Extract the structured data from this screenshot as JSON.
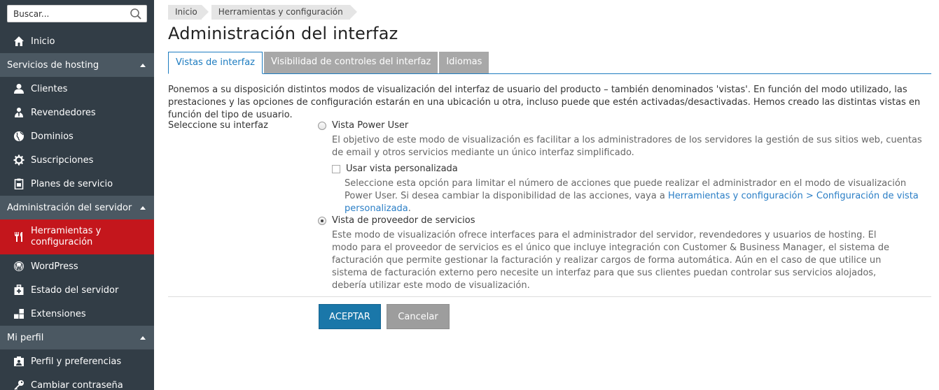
{
  "sidebar": {
    "search": {
      "placeholder": "Buscar..."
    },
    "items": [
      {
        "label": "Inicio",
        "icon": "home-icon"
      }
    ],
    "sections": [
      {
        "title": "Servicios de hosting",
        "items": [
          {
            "label": "Clientes",
            "icon": "user-icon"
          },
          {
            "label": "Revendedores",
            "icon": "reseller-icon"
          },
          {
            "label": "Dominios",
            "icon": "globe-icon"
          },
          {
            "label": "Suscripciones",
            "icon": "gear-icon"
          },
          {
            "label": "Planes de servicio",
            "icon": "plan-icon"
          }
        ]
      },
      {
        "title": "Administración del servidor",
        "items": [
          {
            "label": "Herramientas y configuración",
            "icon": "tools-icon",
            "active": true
          },
          {
            "label": "WordPress",
            "icon": "wordpress-icon"
          },
          {
            "label": "Estado del servidor",
            "icon": "server-status-icon"
          },
          {
            "label": "Extensiones",
            "icon": "extensions-icon"
          }
        ]
      },
      {
        "title": "Mi perfil",
        "items": [
          {
            "label": "Perfil y preferencias",
            "icon": "profile-icon"
          },
          {
            "label": "Cambiar contraseña",
            "icon": "key-icon"
          }
        ]
      }
    ]
  },
  "breadcrumb": [
    "Inicio",
    "Herramientas y configuración"
  ],
  "page_title": "Administración del interfaz",
  "tabs": [
    {
      "label": "Vistas de interfaz",
      "active": true
    },
    {
      "label": "Visibilidad de controles del interfaz",
      "active": false
    },
    {
      "label": "Idiomas",
      "active": false
    }
  ],
  "description": "Ponemos a su disposición distintos modos de visualización del interfaz de usuario del producto – también denominados 'vistas'. En función del modo utilizado, las prestaciones y las opciones de configuración estarán en una ubicación u otra, incluso puede que estén activadas/desactivadas. Hemos creado las distintas vistas en función del tipo de usuario.",
  "form": {
    "label": "Seleccione su interfaz",
    "option_power": {
      "label": "Vista Power User",
      "help": "El objetivo de este modo de visualización es facilitar a los administradores de los servidores la gestión de sus sitios web, cuentas de email y otros servicios mediante un único interfaz simplificado.",
      "checked": false
    },
    "custom_view": {
      "label": "Usar vista personalizada",
      "help_prefix": "Seleccione esta opción para limitar el número de acciones que puede realizar el administrador en el modo de visualización Power User. Si desea cambiar la disponibilidad de las acciones, vaya a ",
      "help_link": "Herramientas y configuración > Configuración de vista personalizada",
      "help_suffix": ".",
      "checked": false
    },
    "option_provider": {
      "label": "Vista de proveedor de servicios",
      "help": "Este modo de visualización ofrece interfaces para el administrador del servidor, revendedores y usuarios de hosting. El modo para el proveedor de servicios es el único que incluye integración con Customer & Business Manager, el sistema de facturación que permite gestionar la facturación y realizar cargos de forma automática. Aún en el caso de que utilice un sistema de facturación externo pero necesite un interfaz para que sus clientes puedan controlar sus servicios alojados, debería utilizar este modo de visualización.",
      "checked": true
    }
  },
  "buttons": {
    "ok": "ACEPTAR",
    "cancel": "Cancelar"
  },
  "colors": {
    "sidebar_bg": "#323d46",
    "active_red": "#c4161c",
    "accent_blue": "#1d7cc0",
    "button_blue": "#1a77a9"
  }
}
